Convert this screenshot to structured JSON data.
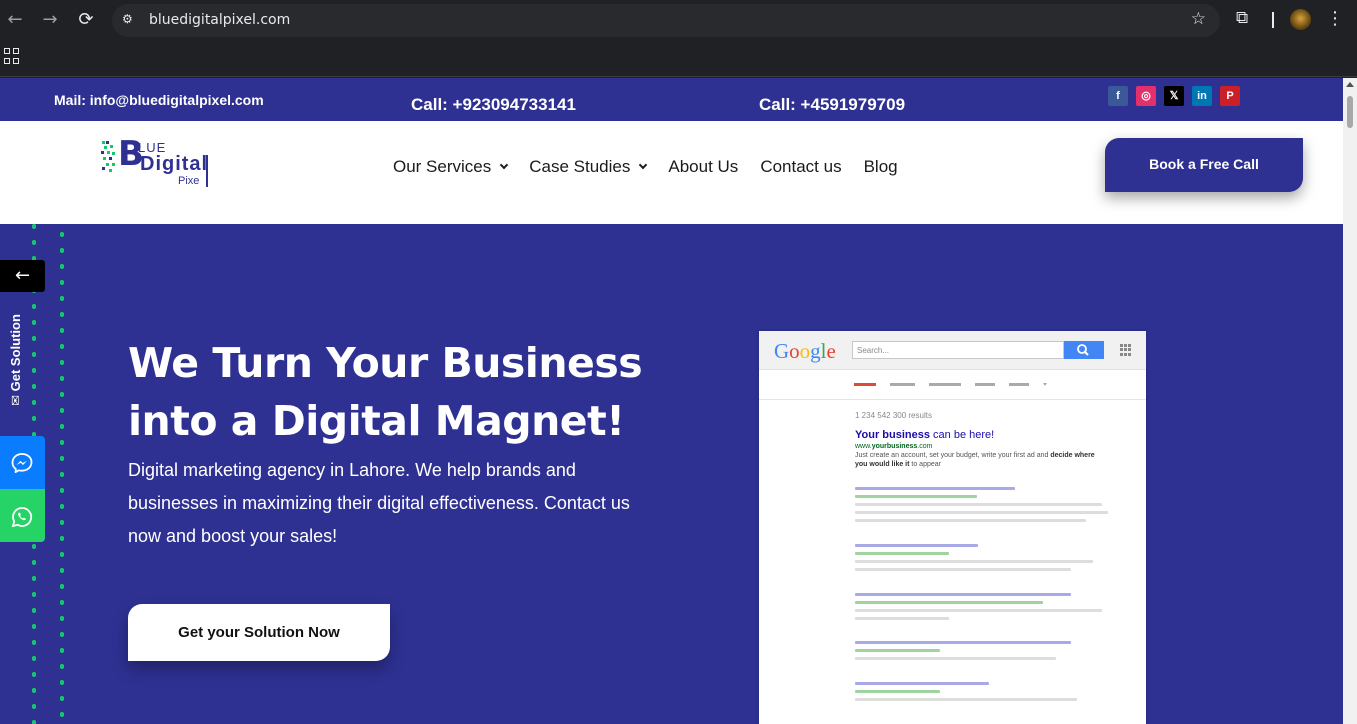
{
  "browser": {
    "url": "bluedigitalpixel.com"
  },
  "topbar": {
    "mail": "Mail: info@bluedigitalpixel.com",
    "call1": "Call: +923094733141",
    "call2": "Call: +4591979709",
    "socials": [
      {
        "icon": "facebook-icon",
        "glyph": "f",
        "color": "#3b5998"
      },
      {
        "icon": "instagram-icon",
        "glyph": "◎",
        "color": "#e1306c"
      },
      {
        "icon": "x-icon",
        "glyph": "𝕏",
        "color": "#000000"
      },
      {
        "icon": "linkedin-icon",
        "glyph": "in",
        "color": "#0077b5"
      },
      {
        "icon": "pinterest-icon",
        "glyph": "P",
        "color": "#cb2027"
      }
    ]
  },
  "header": {
    "logo": {
      "b": "B",
      "lue": "LUE",
      "digital": "Digital",
      "pixe": "Pixe"
    },
    "menu": [
      {
        "label": "Our Services",
        "dropdown": true
      },
      {
        "label": "Case Studies",
        "dropdown": true
      },
      {
        "label": "About Us",
        "dropdown": false
      },
      {
        "label": "Contact us",
        "dropdown": false
      },
      {
        "label": "Blog",
        "dropdown": false
      }
    ],
    "book_label": "Book a Free Call"
  },
  "sidebar": {
    "arrow": "←",
    "solution_label": "Get Solution"
  },
  "hero": {
    "headline_line1": "We Turn Your Business",
    "headline_line2": "into a Digital Magnet!",
    "subtext": "Digital marketing agency in Lahore. We help brands and businesses in maximizing their digital effectiveness. Contact us now and boost your sales!",
    "cta_label": "Get your Solution Now"
  },
  "mockup": {
    "search_placeholder": "Search...",
    "results_count": "1 234 542 300 results",
    "ad_title_bold": "Your business",
    "ad_title_rest": " can be here!",
    "ad_url_prefix": "www.",
    "ad_url_bold": "yourbusiness",
    "ad_url_suffix": ".com",
    "ad_desc_1": "Just create an account, set your budget, write your first ad and ",
    "ad_desc_bold": "decide where you would like it",
    "ad_desc_2": " to appear"
  },
  "colors": {
    "brand": "#2e3192",
    "accent_green": "#16c86d",
    "messenger": "#0a7cff",
    "whatsapp": "#25d366"
  }
}
